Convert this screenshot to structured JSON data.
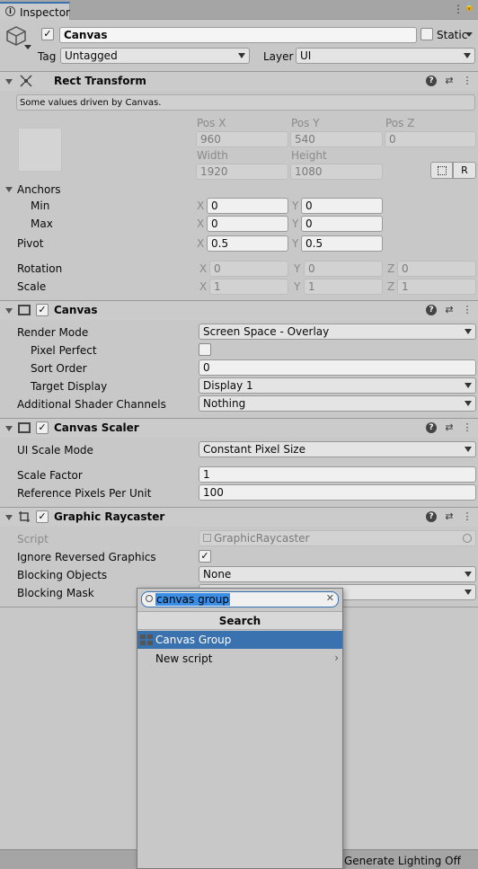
{
  "tab": {
    "label": "Inspector"
  },
  "object": {
    "name": "Canvas",
    "static_label": "Static",
    "tag_label": "Tag",
    "tag_value": "Untagged",
    "layer_label": "Layer",
    "layer_value": "UI"
  },
  "rect_transform": {
    "title": "Rect Transform",
    "note": "Some values driven by Canvas.",
    "pos_x_label": "Pos X",
    "pos_y_label": "Pos Y",
    "pos_z_label": "Pos Z",
    "pos_x": "960",
    "pos_y": "540",
    "pos_z": "0",
    "width_label": "Width",
    "height_label": "Height",
    "width": "1920",
    "height": "1080",
    "r_button": "R",
    "anchors_label": "Anchors",
    "min_label": "Min",
    "min_x": "0",
    "min_y": "0",
    "max_label": "Max",
    "max_x": "0",
    "max_y": "0",
    "pivot_label": "Pivot",
    "pivot_x": "0.5",
    "pivot_y": "0.5",
    "rotation_label": "Rotation",
    "rot_x": "0",
    "rot_y": "0",
    "rot_z": "0",
    "scale_label": "Scale",
    "scale_x": "1",
    "scale_y": "1",
    "scale_z": "1",
    "axis_x": "X",
    "axis_y": "Y",
    "axis_z": "Z"
  },
  "canvas": {
    "title": "Canvas",
    "render_mode_label": "Render Mode",
    "render_mode": "Screen Space - Overlay",
    "pixel_perfect_label": "Pixel Perfect",
    "sort_order_label": "Sort Order",
    "sort_order": "0",
    "target_display_label": "Target Display",
    "target_display": "Display 1",
    "shader_channels_label": "Additional Shader Channels",
    "shader_channels": "Nothing"
  },
  "canvas_scaler": {
    "title": "Canvas Scaler",
    "ui_scale_mode_label": "UI Scale Mode",
    "ui_scale_mode": "Constant Pixel Size",
    "scale_factor_label": "Scale Factor",
    "scale_factor": "1",
    "ref_ppu_label": "Reference Pixels Per Unit",
    "ref_ppu": "100"
  },
  "graphic_raycaster": {
    "title": "Graphic Raycaster",
    "script_label": "Script",
    "script_value": "GraphicRaycaster",
    "ignore_reversed_label": "Ignore Reversed Graphics",
    "blocking_objects_label": "Blocking Objects",
    "blocking_objects": "None",
    "blocking_mask_label": "Blocking Mask"
  },
  "popup": {
    "search_value": "canvas group",
    "header": "Search",
    "items": [
      {
        "label": "Canvas Group"
      },
      {
        "label": "New script"
      }
    ]
  },
  "status_bar": {
    "text": "Generate Lighting Off"
  }
}
